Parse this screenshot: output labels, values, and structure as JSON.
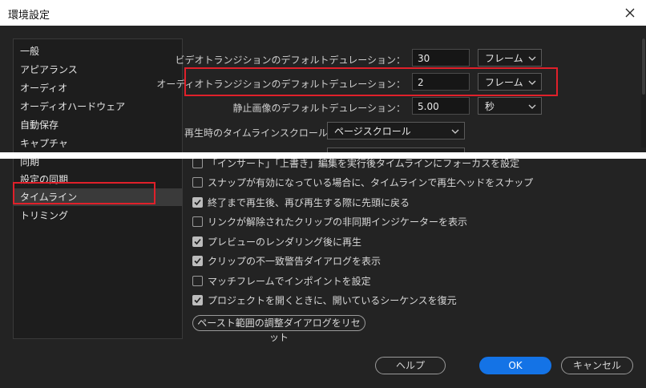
{
  "window": {
    "title": "環境設定"
  },
  "sidebar": {
    "items": [
      {
        "label": "一般"
      },
      {
        "label": "アピアランス"
      },
      {
        "label": "オーディオ"
      },
      {
        "label": "オーディオハードウェア"
      },
      {
        "label": "自動保存"
      },
      {
        "label": "キャプチャ"
      },
      {
        "label": "同期"
      },
      {
        "label": "設定の同期"
      },
      {
        "label": "タイムライン",
        "selected": true
      },
      {
        "label": "トリミング"
      }
    ]
  },
  "settings": {
    "video_transition": {
      "label": "ビデオトランジションのデフォルトデュレーション：",
      "value": "30",
      "unit": "フレーム"
    },
    "audio_transition": {
      "label": "オーディオトランジションのデフォルトデュレーション：",
      "value": "2",
      "unit": "フレーム"
    },
    "still_image": {
      "label": "静止画像のデフォルトデュレーション：",
      "value": "5.00",
      "unit": "秒"
    },
    "timeline_scroll": {
      "label": "再生時のタイムラインスクロール：",
      "value": "ページスクロール"
    }
  },
  "checkboxes": [
    {
      "label": "「インサート」「上書き」編集を実行後タイムラインにフォーカスを設定",
      "checked": false
    },
    {
      "label": "スナップが有効になっている場合に、タイムラインで再生ヘッドをスナップ",
      "checked": false
    },
    {
      "label": "終了まで再生後、再び再生する際に先頭に戻る",
      "checked": true
    },
    {
      "label": "リンクが解除されたクリップの非同期インジケーターを表示",
      "checked": false
    },
    {
      "label": "プレビューのレンダリング後に再生",
      "checked": true
    },
    {
      "label": "クリップの不一致警告ダイアログを表示",
      "checked": true
    },
    {
      "label": "マッチフレームでインポイントを設定",
      "checked": false
    },
    {
      "label": "プロジェクトを開くときに、開いているシーケンスを復元",
      "checked": true
    }
  ],
  "reset_button": {
    "label": "ペースト範囲の調整ダイアログをリセット"
  },
  "footer": {
    "help_label": "ヘルプ",
    "ok_label": "OK",
    "cancel_label": "キャンセル"
  },
  "colors": {
    "highlight_red": "#e0202a",
    "primary_blue": "#1473e6",
    "background": "#232323"
  }
}
